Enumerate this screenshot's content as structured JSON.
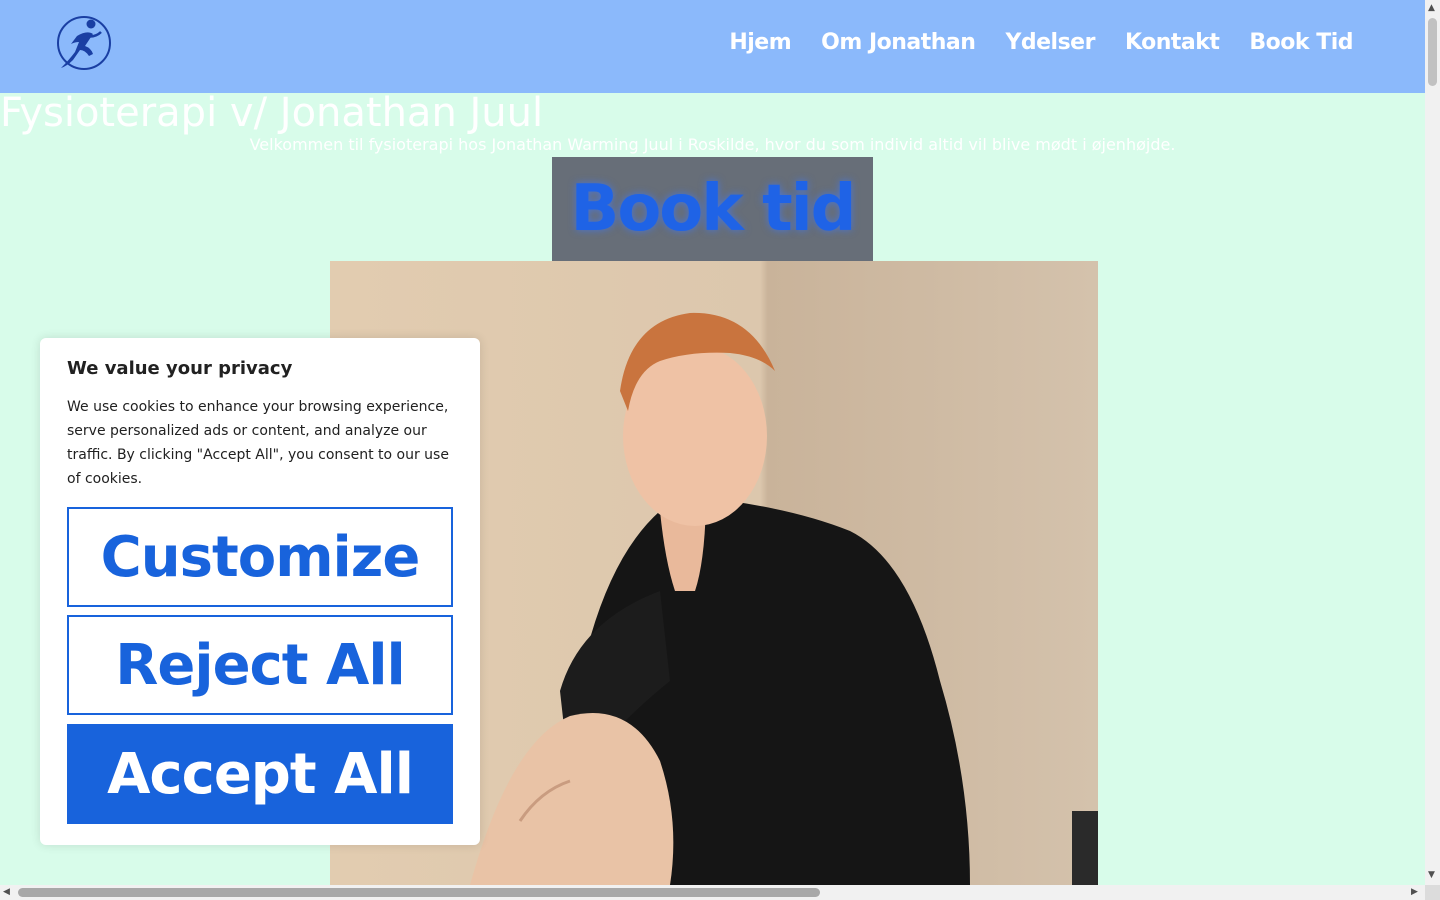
{
  "header": {
    "nav": [
      "Hjem",
      "Om Jonathan",
      "Ydelser",
      "Kontakt",
      "Book Tid"
    ]
  },
  "hero": {
    "title": "Fysioterapi v/ Jonathan Juul",
    "subtitle": "Velkommen til fysioterapi hos Jonathan Warming Juul i Roskilde, hvor du som individ altid vil blive mødt i øjenhøjde.",
    "book_button": "Book tid"
  },
  "cookie_banner": {
    "title": "We value your privacy",
    "text": "We use cookies to enhance your browsing experience, serve personalized ads or content, and analyze our traffic. By clicking \"Accept All\", you consent to our use of cookies.",
    "customize": "Customize",
    "reject": "Reject All",
    "accept": "Accept All"
  },
  "colors": {
    "header_bg": "#8bb9fb",
    "page_bg": "#d8fcea",
    "cookie_accent": "#1863dc",
    "book_button_bg": "#676e78"
  },
  "icons": [
    "runner-logo-icon",
    "arrow-up-icon",
    "arrow-down-icon",
    "arrow-left-icon",
    "arrow-right-icon"
  ]
}
